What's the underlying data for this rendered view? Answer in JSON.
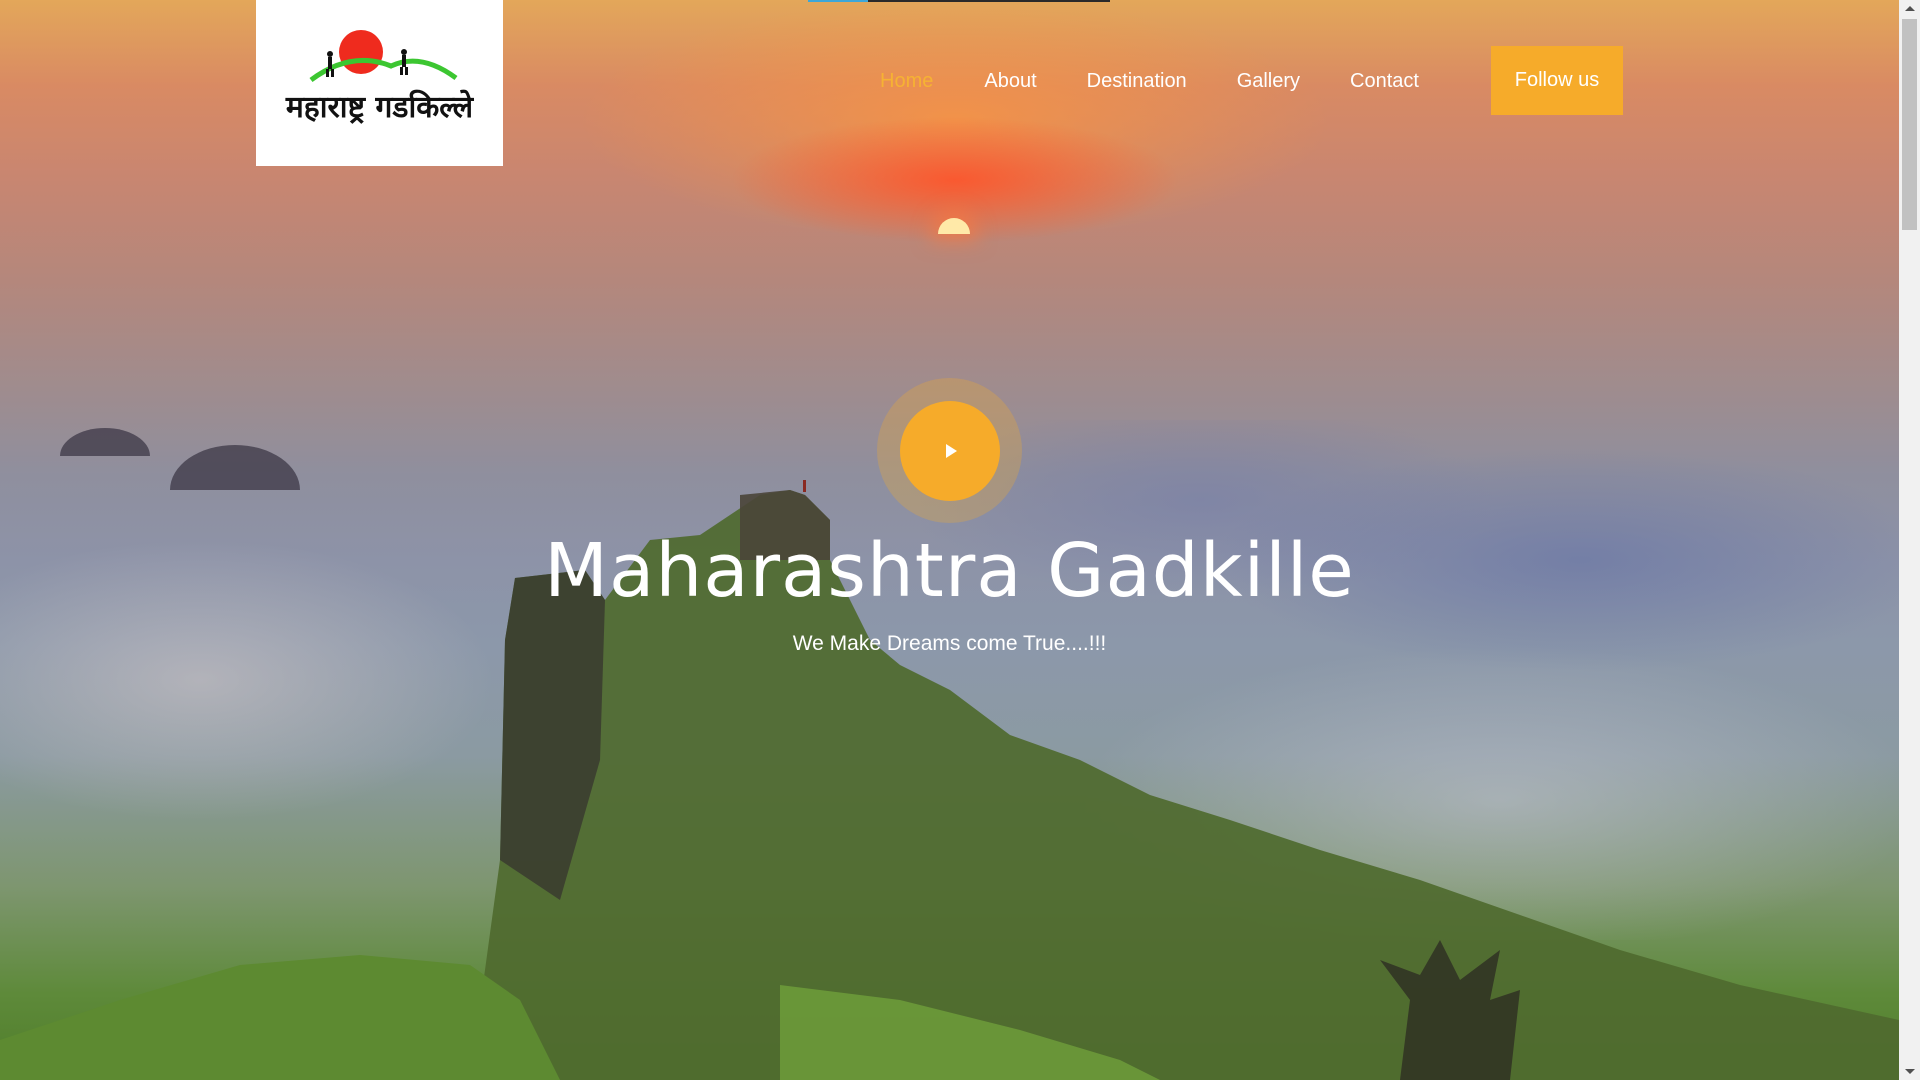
{
  "header": {
    "logo_text": "महाराष्ट्र गडकिल्ले",
    "nav": [
      {
        "label": "Home",
        "active": true
      },
      {
        "label": "About",
        "active": false
      },
      {
        "label": "Destination",
        "active": false
      },
      {
        "label": "Gallery",
        "active": false
      },
      {
        "label": "Contact",
        "active": false
      }
    ],
    "follow_button": "Follow us"
  },
  "hero": {
    "title": "Maharashtra Gadkille",
    "subtitle": "We Make Dreams come True....!!!",
    "play_icon": "play-icon"
  },
  "colors": {
    "accent": "#f6ab2a",
    "nav_active": "#f6b233",
    "text_light": "#ffffff"
  },
  "icons": {
    "logo_sun": "sun-icon",
    "logo_hikers": "hiker-icon",
    "scroll_up": "chevron-up-icon",
    "scroll_down": "chevron-down-icon"
  }
}
